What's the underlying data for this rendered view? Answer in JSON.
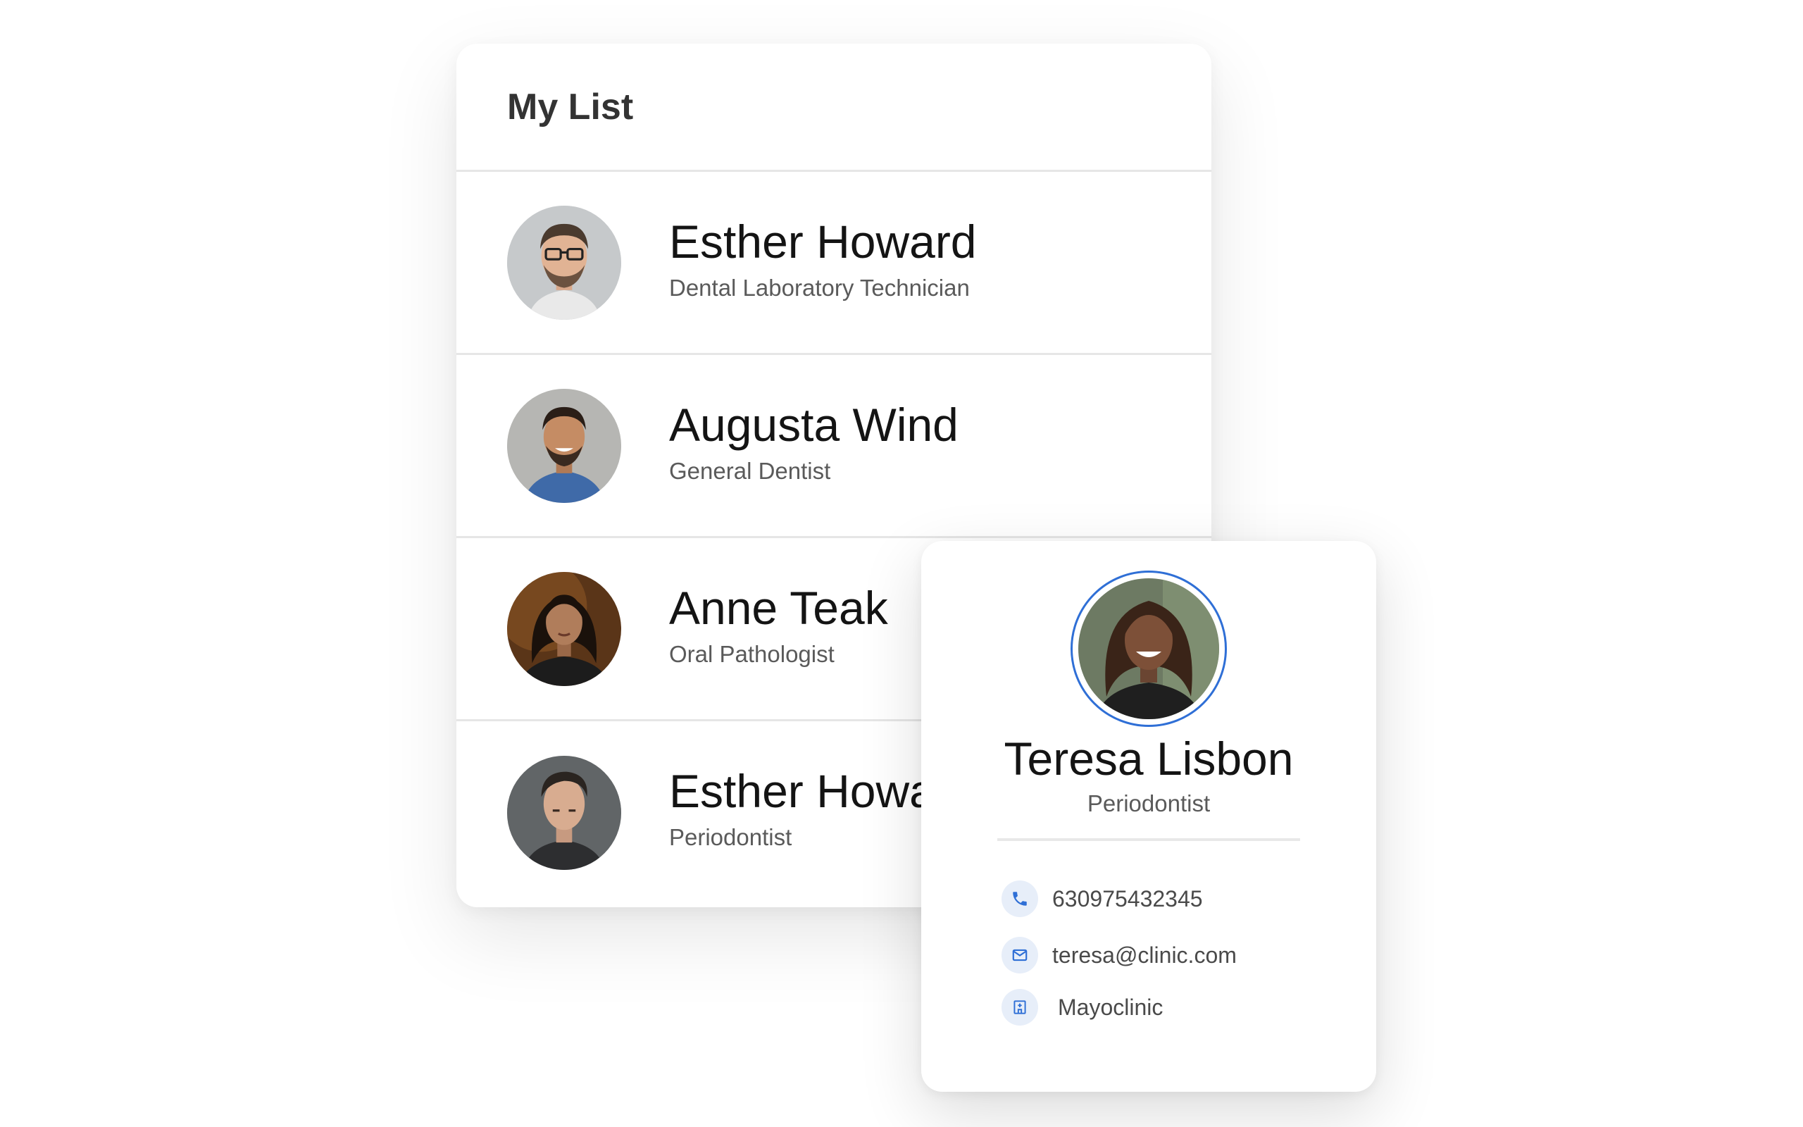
{
  "list": {
    "title": "My List",
    "items": [
      {
        "name": "Esther Howard",
        "role": "Dental Laboratory Technician"
      },
      {
        "name": "Augusta Wind",
        "role": "General Dentist"
      },
      {
        "name": "Anne Teak",
        "role": "Oral Pathologist"
      },
      {
        "name": "Esther Howard",
        "role": "Periodontist"
      }
    ]
  },
  "profile": {
    "name": "Teresa Lisbon",
    "role": "Periodontist",
    "contacts": {
      "phone": "630975432345",
      "email": "teresa@clinic.com",
      "clinic": "Mayoclinic"
    }
  },
  "colors": {
    "accent": "#2f6fd6",
    "icon_bg": "#e7eef9",
    "divider": "#e6e6e6"
  },
  "icons": {
    "phone": "phone-icon",
    "email": "mail-icon",
    "clinic": "building-icon"
  }
}
